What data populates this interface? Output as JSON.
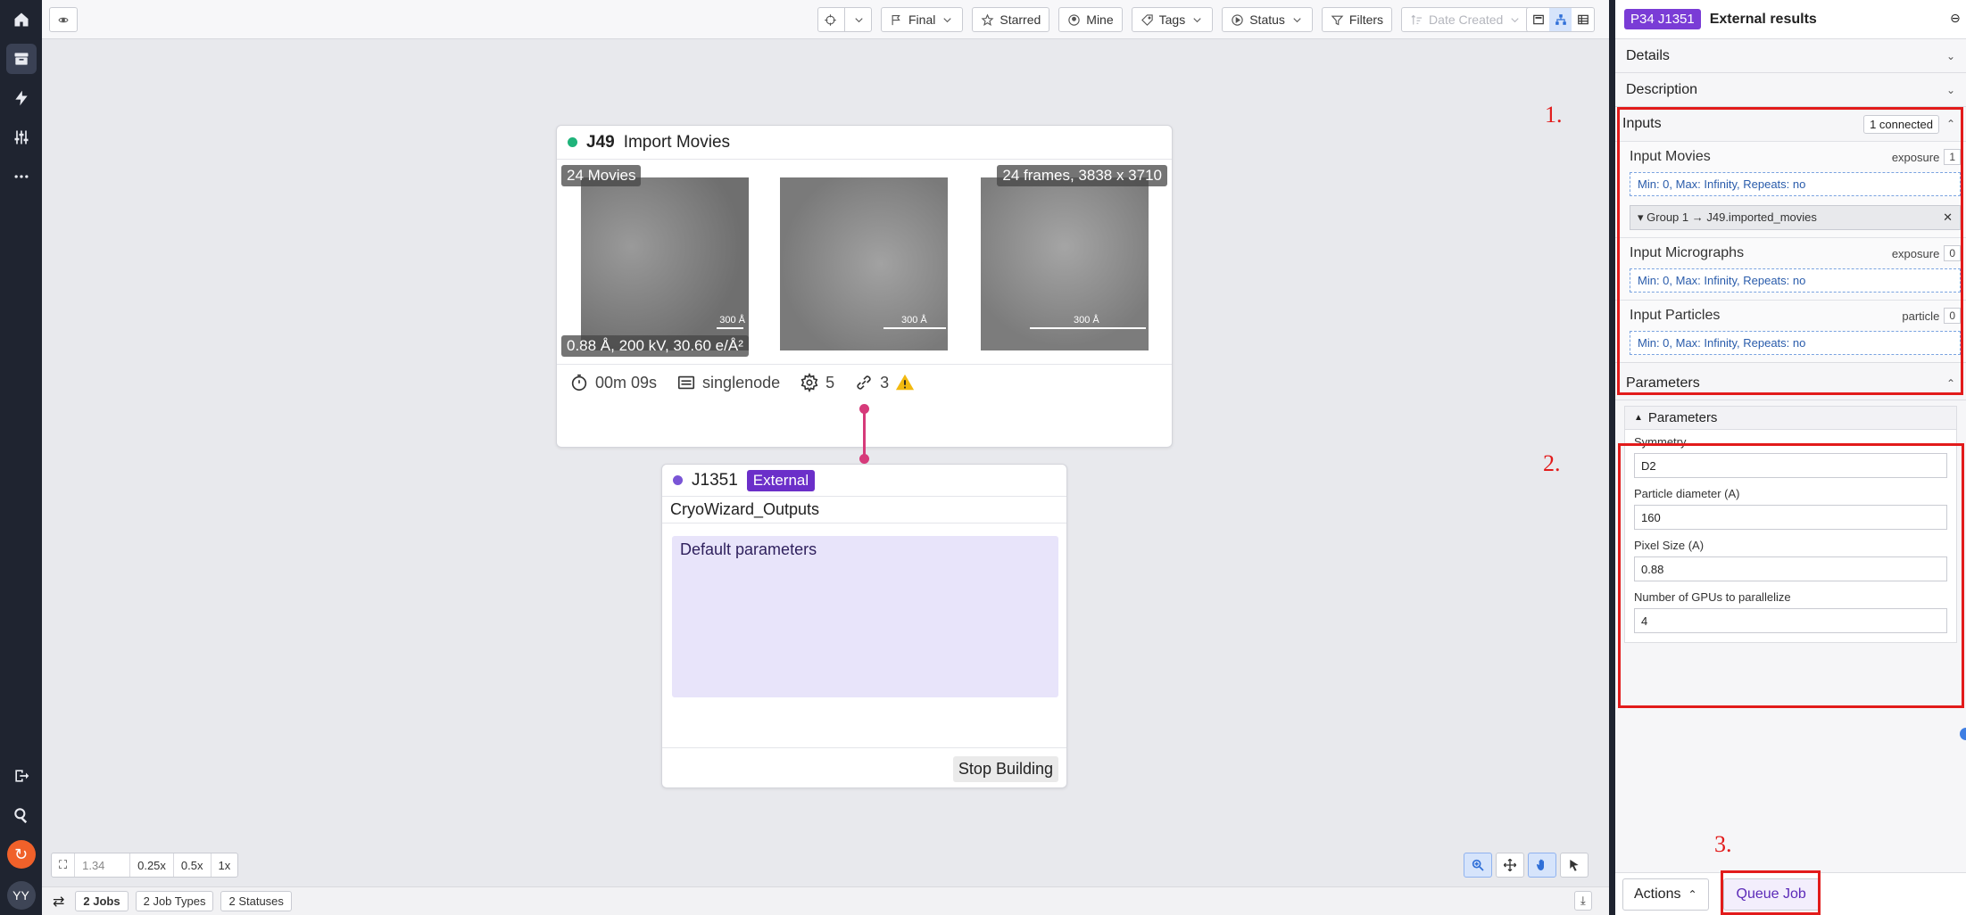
{
  "toolbar": {
    "final": "Final",
    "starred": "Starred",
    "mine": "Mine",
    "tags": "Tags",
    "status": "Status",
    "filters": "Filters",
    "date_created": "Date Created"
  },
  "job_import": {
    "id": "J49",
    "title": "Import Movies",
    "status_color": "#1fb37a",
    "movie_count": "24 Movies",
    "frames": "24 frames, 3838 x 3710",
    "exposure_info": "0.88 Å, 200 kV, 30.60 e/Å²",
    "scale_label": "300 Å",
    "time": "00m 09s",
    "lane": "singlenode",
    "params": "5",
    "links": "3"
  },
  "job_external": {
    "id": "J1351",
    "badge": "External",
    "status_color": "#7a55d6",
    "name": "CryoWizard_Outputs",
    "default_params": "Default parameters",
    "stop_button": "Stop Building"
  },
  "zoom": {
    "value": "1.34",
    "options": [
      "0.25x",
      "0.5x",
      "1x"
    ]
  },
  "statusbar": {
    "jobs_count": "2",
    "jobs_label": "Jobs",
    "job_types": "2 Job Types",
    "statuses": "2 Statuses"
  },
  "rail": {
    "avatar": "YY"
  },
  "panel": {
    "badge": "P34 J1351",
    "title": "External results",
    "sections": {
      "details": "Details",
      "description": "Description",
      "inputs": "Inputs",
      "parameters": "Parameters"
    },
    "connected": "1 connected",
    "inputs": [
      {
        "name": "Input Movies",
        "type": "exposure",
        "count": "1",
        "rule": "Min: 0, Max: Infinity, Repeats: no",
        "group": "Group 1 → J49.imported_movies"
      },
      {
        "name": "Input Micrographs",
        "type": "exposure",
        "count": "0",
        "rule": "Min: 0, Max: Infinity, Repeats: no"
      },
      {
        "name": "Input Particles",
        "type": "particle",
        "count": "0",
        "rule": "Min: 0, Max: Infinity, Repeats: no"
      }
    ],
    "param_group": "Parameters",
    "params": [
      {
        "label": "Symmetry",
        "value": "D2"
      },
      {
        "label": "Particle diameter (A)",
        "value": "160"
      },
      {
        "label": "Pixel Size (A)",
        "value": "0.88"
      },
      {
        "label": "Number of GPUs to parallelize",
        "value": "4"
      }
    ],
    "actions": "Actions",
    "queue": "Queue Job"
  },
  "annotations": [
    "1.",
    "2.",
    "3."
  ]
}
